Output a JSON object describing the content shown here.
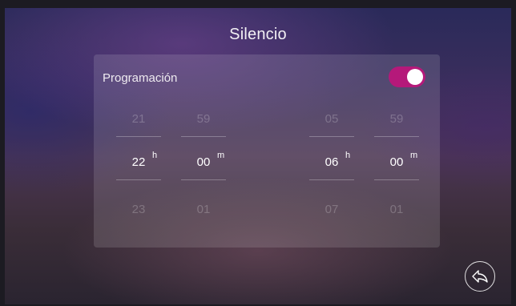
{
  "header": {
    "title": "Silencio"
  },
  "schedule": {
    "label": "Programación",
    "enabled": true,
    "accent_color": "#b5197a",
    "start": {
      "hours": {
        "prev": "21",
        "current": "22",
        "next": "23",
        "unit": "h"
      },
      "minutes": {
        "prev": "59",
        "current": "00",
        "next": "01",
        "unit": "m"
      }
    },
    "end": {
      "hours": {
        "prev": "05",
        "current": "06",
        "next": "07",
        "unit": "h"
      },
      "minutes": {
        "prev": "59",
        "current": "00",
        "next": "01",
        "unit": "m"
      }
    }
  },
  "footer": {
    "back_icon": "return-arrow-icon"
  }
}
